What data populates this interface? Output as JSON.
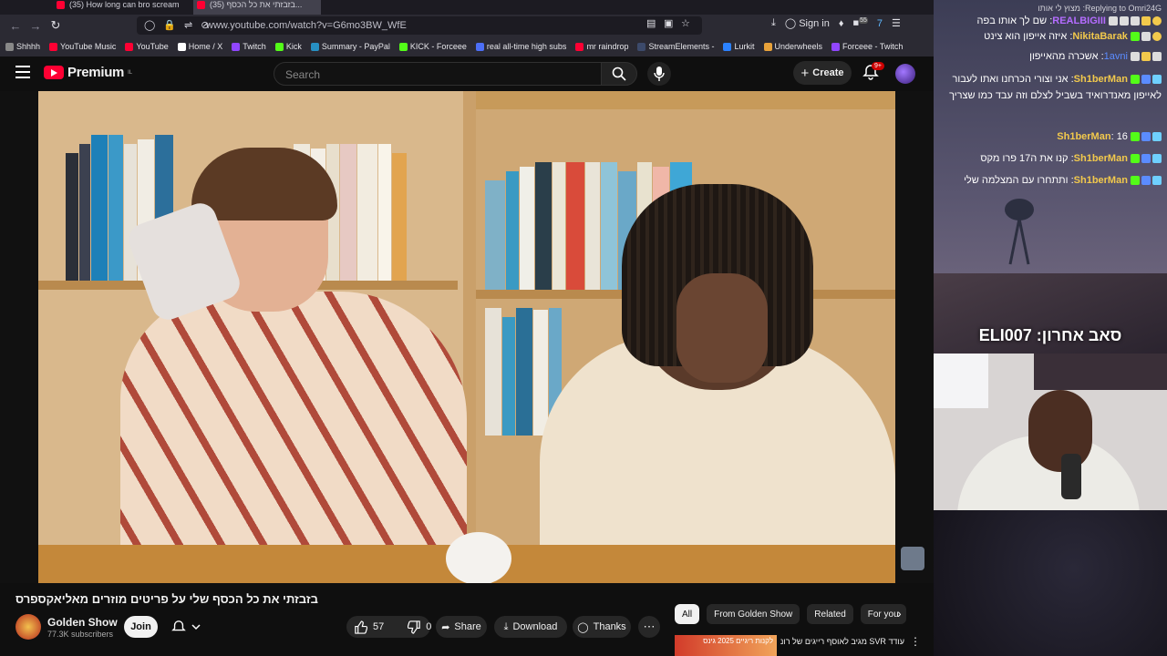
{
  "browser": {
    "tabs": [
      {
        "label": "(35) How long can bro scream"
      },
      {
        "label": "(35) בזבזתי את כל הכסף..."
      }
    ],
    "url": "www.youtube.com/watch?v=G6mo3BW_WfE",
    "sign_in": "Sign in",
    "ext_badge": "55",
    "bookmarks": [
      {
        "label": "Shhhh",
        "color": "#888888"
      },
      {
        "label": "YouTube Music",
        "color": "#ff0033"
      },
      {
        "label": "YouTube",
        "color": "#ff0033"
      },
      {
        "label": "Home / X",
        "color": "#ffffff"
      },
      {
        "label": "Twitch",
        "color": "#9146ff"
      },
      {
        "label": "Kick",
        "color": "#53fc18"
      },
      {
        "label": "Summary - PayPal",
        "color": "#2790c3"
      },
      {
        "label": "KICK - Forceee",
        "color": "#53fc18"
      },
      {
        "label": "real all-time high subs",
        "color": "#4c6ef5"
      },
      {
        "label": "mr raindrop",
        "color": "#ff0033"
      },
      {
        "label": "StreamElements -",
        "color": "#3c4a6b"
      },
      {
        "label": "Lurkit",
        "color": "#2b82ff"
      },
      {
        "label": "Underwheels",
        "color": "#e8a23a"
      },
      {
        "label": "Forceee - Twitch",
        "color": "#9146ff"
      }
    ]
  },
  "youtube": {
    "logo_text": "Premium",
    "logo_sup": "IL",
    "search_placeholder": "Search",
    "create_label": "Create",
    "notif_count": "9+"
  },
  "video": {
    "title": "בזבזתי את כל הכסף שלי על פריטים מוזרים מאליאקספרס",
    "channel_name": "Golden Show",
    "subscribers": "77.3K subscribers",
    "join_label": "Join",
    "likes": "57",
    "dislikes": "0",
    "share_label": "Share",
    "download_label": "Download",
    "thanks_label": "Thanks"
  },
  "chips": [
    "All",
    "From Golden Show",
    "Related",
    "For you"
  ],
  "recommendation": {
    "thumb_text": "לקנות ריגיים 2025 גינס",
    "title": "עודד SVR מגיב לאוסף רייגים של רונן"
  },
  "stream_overlay": {
    "reply_header": "Replying to Omri24G: מצוץ לי אותו",
    "chat": [
      {
        "user": "REALBIGIII",
        "message": "שם לך אותו בפה",
        "color": "#b46cff"
      },
      {
        "user": "NikitaBarak",
        "message": "איזה אייפון הוא צינט",
        "color": "#f2c94c"
      },
      {
        "user": "1avni",
        "message": "אשכרה מהאייפון",
        "color": "#5b8cff"
      },
      {
        "user": "Sh1berMan",
        "message": "אני וצורי הכרחנו ואתו לעבור לאייפון מאנדרואיד בשביל לצלם וזה עבד כמו שצריך",
        "color": "#f2c94c"
      },
      {
        "user": "Sh1berMan",
        "message": "16",
        "color": "#f2c94c"
      },
      {
        "user": "Sh1berMan",
        "message": "קנו את ה17 פרו מקס",
        "color": "#f2c94c"
      },
      {
        "user": "Sh1berMan",
        "message": "ותתחרו עם המצלמה שלי",
        "color": "#f2c94c"
      }
    ],
    "last_sub_label": "סאב אחרון:",
    "last_sub_user": "ELI007"
  }
}
